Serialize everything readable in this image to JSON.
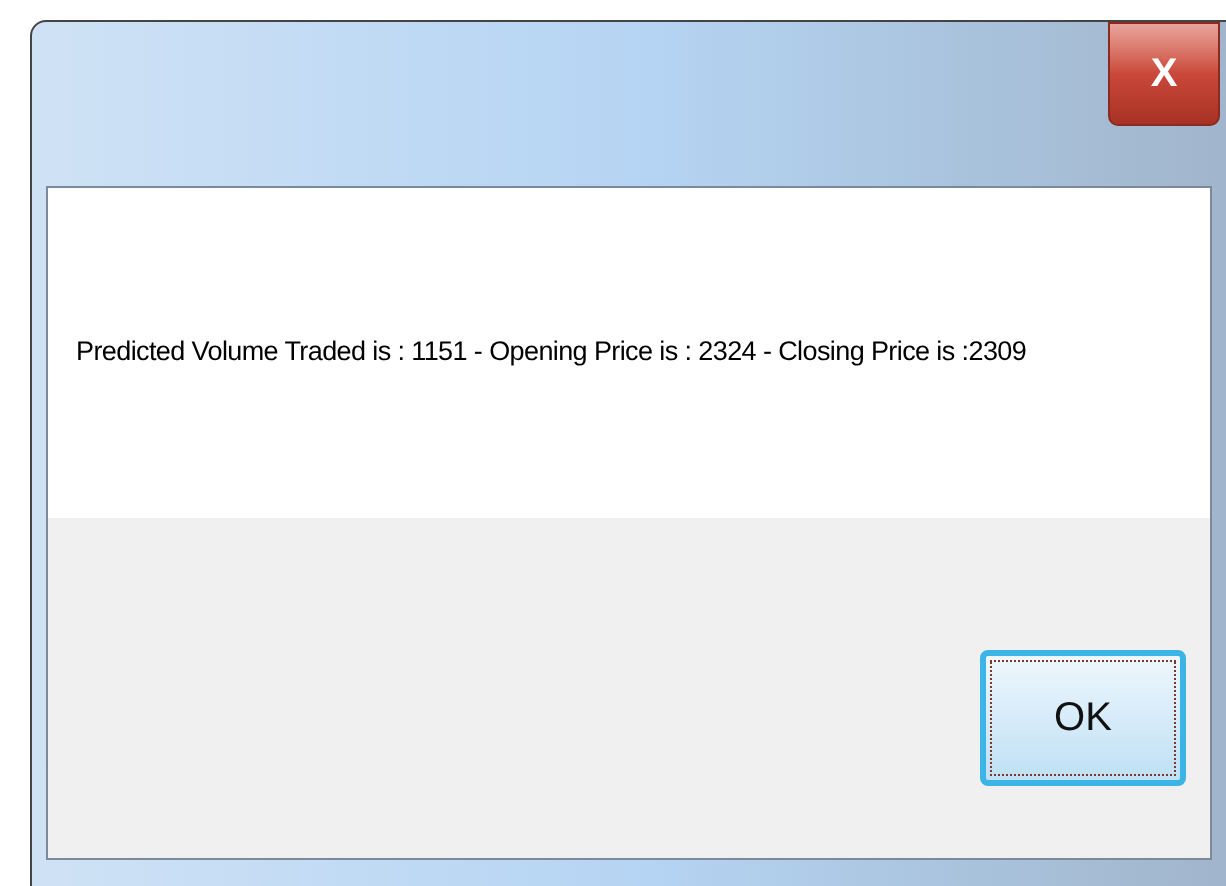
{
  "window": {
    "close_label": "X"
  },
  "message": "Predicted Volume Traded is : 1151 - Opening Price is : 2324 - Closing Price is :2309",
  "buttons": [
    {
      "label": "OK",
      "focused": true
    }
  ]
}
